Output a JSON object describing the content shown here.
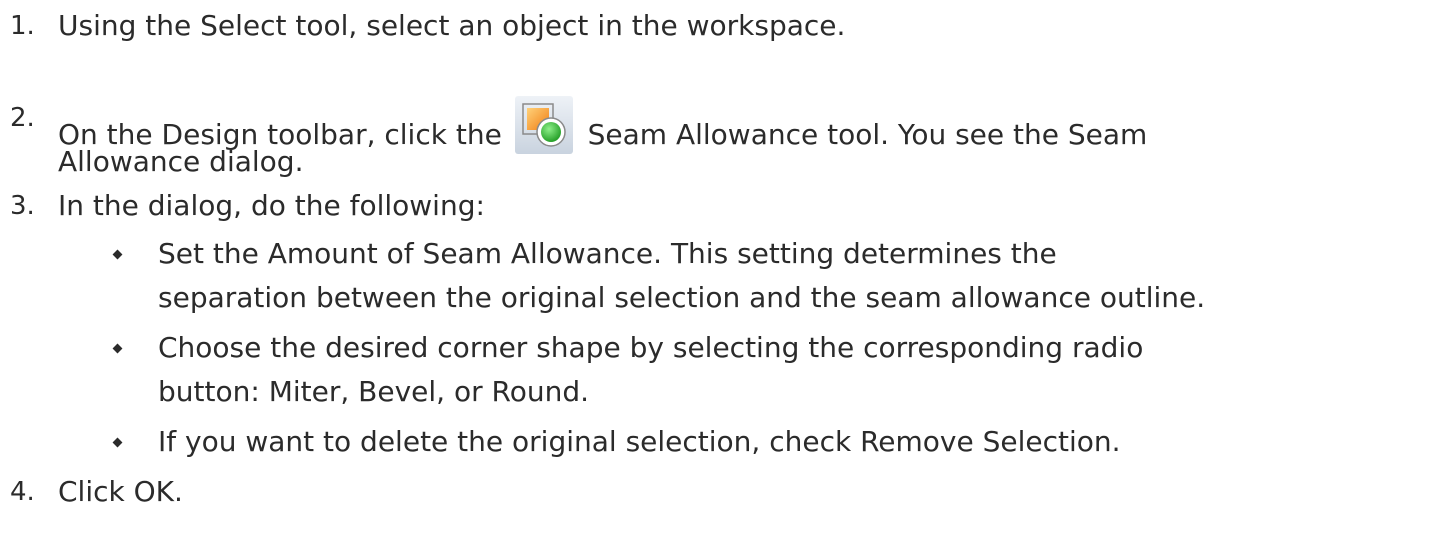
{
  "steps": [
    {
      "number": "1.",
      "text": "Using the Select tool, select an object in the workspace."
    },
    {
      "number": "2.",
      "text_before_icon": "On the Design toolbar, click the",
      "icon": "seam-allowance-icon",
      "text_after_icon": "Seam Allowance tool. You see the Seam",
      "text_line2": "Allowance dialog."
    },
    {
      "number": "3.",
      "text": "In the dialog, do the following:",
      "bullets": [
        {
          "line1": "Set the Amount of Seam Allowance. This setting determines the",
          "line2": "separation between the original selection and the seam allowance outline."
        },
        {
          "line1": "Choose the desired corner shape by selecting the corresponding radio",
          "line2": "button: Miter, Bevel, or Round."
        },
        {
          "line1": "If you want to delete the original selection, check Remove Selection."
        }
      ]
    },
    {
      "number": "4.",
      "text": "Click OK."
    }
  ],
  "colors": {
    "text": "#2b2b2b",
    "icon_square": "#f59a1e",
    "icon_circle": "#2fb32f"
  }
}
